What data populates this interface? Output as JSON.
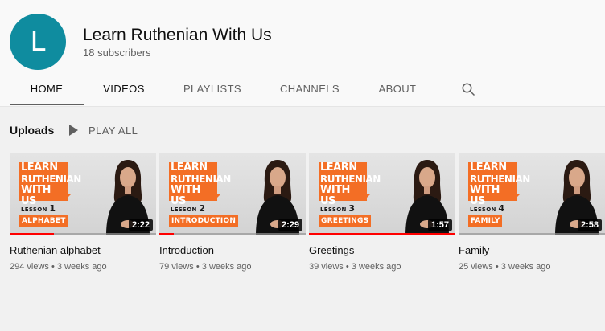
{
  "channel": {
    "avatar_letter": "L",
    "avatar_color": "#0f8c9f",
    "name": "Learn Ruthenian With Us",
    "subscribers": "18 subscribers"
  },
  "tabs": [
    {
      "label": "HOME",
      "active": true
    },
    {
      "label": "VIDEOS",
      "active": false
    },
    {
      "label": "PLAYLISTS",
      "active": false
    },
    {
      "label": "CHANNELS",
      "active": false
    },
    {
      "label": "ABOUT",
      "active": false
    }
  ],
  "search_icon": "search-icon",
  "uploads": {
    "title": "Uploads",
    "play_all": "PLAY ALL"
  },
  "thumbnail_text": {
    "logo_line1": "LEARN",
    "logo_line2": "RUTHENIAN",
    "logo_line3": "WITH US",
    "lesson_word": "LESSON"
  },
  "accent_color": "#f36e25",
  "videos": [
    {
      "title": "Ruthenian alphabet",
      "views": "294 views",
      "age": "3 weeks ago",
      "duration": "2:22",
      "lesson_number": "1",
      "topic": "ALPHABET",
      "progress": 0.3
    },
    {
      "title": "Introduction",
      "views": "79 views",
      "age": "3 weeks ago",
      "duration": "2:29",
      "lesson_number": "2",
      "topic": "INTRODUCTION",
      "progress": 0.1
    },
    {
      "title": "Greetings",
      "views": "39 views",
      "age": "3 weeks ago",
      "duration": "1:57",
      "lesson_number": "3",
      "topic": "GREETINGS",
      "progress": 1.0
    },
    {
      "title": "Family",
      "views": "25 views",
      "age": "3 weeks ago",
      "duration": "2:58",
      "lesson_number": "4",
      "topic": "FAMILY",
      "progress": 0.0
    }
  ]
}
